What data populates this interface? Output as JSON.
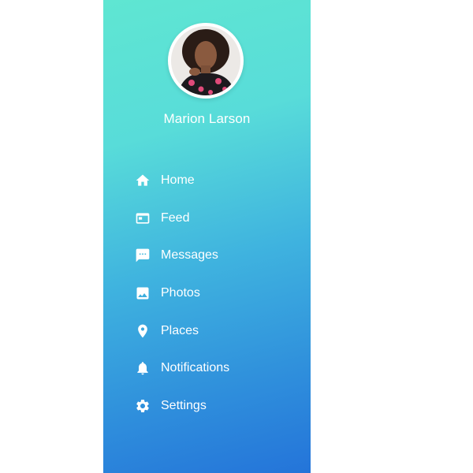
{
  "profile": {
    "name": "Marion Larson"
  },
  "menu": {
    "items": [
      {
        "label": "Home",
        "icon": "home-icon"
      },
      {
        "label": "Feed",
        "icon": "feed-icon"
      },
      {
        "label": "Messages",
        "icon": "messages-icon"
      },
      {
        "label": "Photos",
        "icon": "photos-icon"
      },
      {
        "label": "Places",
        "icon": "place-pin-icon"
      },
      {
        "label": "Notifications",
        "icon": "bell-icon"
      },
      {
        "label": "Settings",
        "icon": "gear-icon"
      }
    ]
  },
  "colors": {
    "gradient_top": "#5fe6d2",
    "gradient_bottom": "#2474d9",
    "text": "#ffffff",
    "page_background": "#ffffff"
  }
}
